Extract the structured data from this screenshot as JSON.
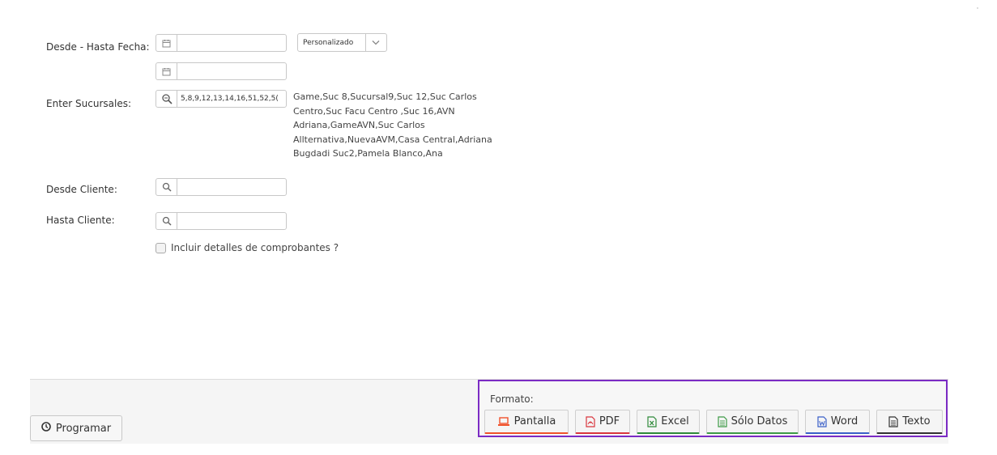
{
  "filters": {
    "date_range_label": "Desde - Hasta Fecha:",
    "date_from_value": "",
    "date_to_value": "",
    "period_select_value": "Personalizado",
    "branches_label": "Enter Sucursales:",
    "branches_input_value": "5,8,9,12,13,14,16,51,52,5(",
    "branches_names": "Game,Suc 8,Sucursal9,Suc 12,Suc Carlos Centro,Suc Facu Centro ,Suc 16,AVN Adriana,GameAVN,Suc Carlos Allternativa,NuevaAVM,Casa Central,Adriana Bugdadi Suc2,Pamela Blanco,Ana",
    "client_from_label": "Desde Cliente:",
    "client_from_value": "",
    "client_to_label": "Hasta Cliente:",
    "client_to_value": "",
    "include_details_label": "Incluir detalles de comprobantes ?",
    "include_details_checked": false
  },
  "footer": {
    "schedule_button_label": "Programar",
    "format_label": "Formato:",
    "format_buttons": [
      {
        "label": "Pantalla",
        "icon": "laptop-icon",
        "accent": "#f0522b"
      },
      {
        "label": "PDF",
        "icon": "pdf-file-icon",
        "accent": "#d9363e"
      },
      {
        "label": "Excel",
        "icon": "excel-file-icon",
        "accent": "#2f8a3a"
      },
      {
        "label": "Sólo Datos",
        "icon": "data-file-icon",
        "accent": "#3e9b47"
      },
      {
        "label": "Word",
        "icon": "word-file-icon",
        "accent": "#3a5fc8"
      },
      {
        "label": "Texto",
        "icon": "text-file-icon",
        "accent": "#333333"
      }
    ],
    "highlight_color": "#7b2bc4"
  }
}
